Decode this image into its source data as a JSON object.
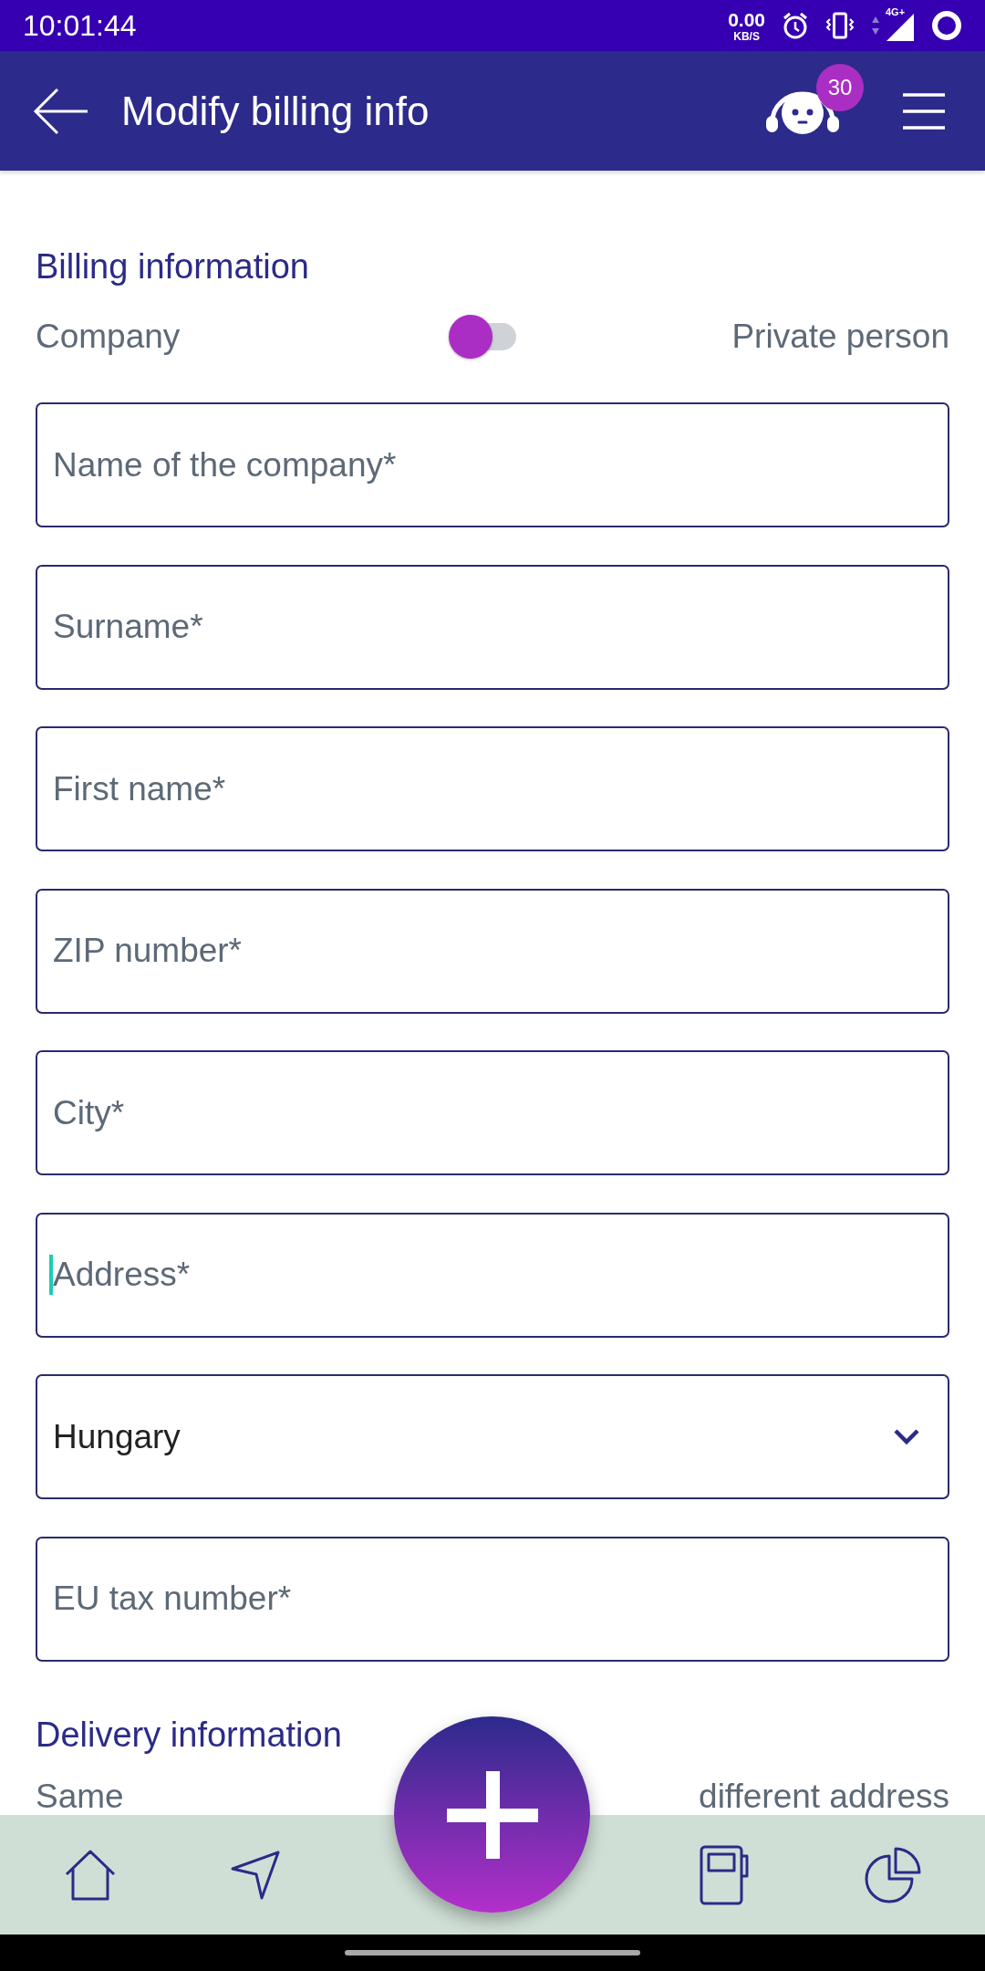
{
  "status_bar": {
    "time": "10:01:44",
    "net_speed": "0.00",
    "net_speed_unit": "KB/S",
    "network_type": "4G+"
  },
  "app_bar": {
    "title": "Modify billing info",
    "support_badge": "30"
  },
  "billing": {
    "heading": "Billing information",
    "type_switch": {
      "left_label": "Company",
      "right_label": "Private person",
      "on": false
    },
    "fields": [
      {
        "kind": "text",
        "placeholder": "Name of the company*",
        "focused": false
      },
      {
        "kind": "text",
        "placeholder": "Surname*",
        "focused": false
      },
      {
        "kind": "text",
        "placeholder": "First name*",
        "focused": false
      },
      {
        "kind": "text",
        "placeholder": "ZIP number*",
        "focused": false
      },
      {
        "kind": "text",
        "placeholder": "City*",
        "focused": false
      },
      {
        "kind": "text",
        "placeholder": "Address*",
        "focused": true
      },
      {
        "kind": "select",
        "value": "Hungary",
        "focused": false
      },
      {
        "kind": "text",
        "placeholder": "EU tax number*",
        "focused": false
      }
    ]
  },
  "delivery": {
    "heading": "Delivery information",
    "left_label": "Same",
    "right_label": "different address"
  }
}
